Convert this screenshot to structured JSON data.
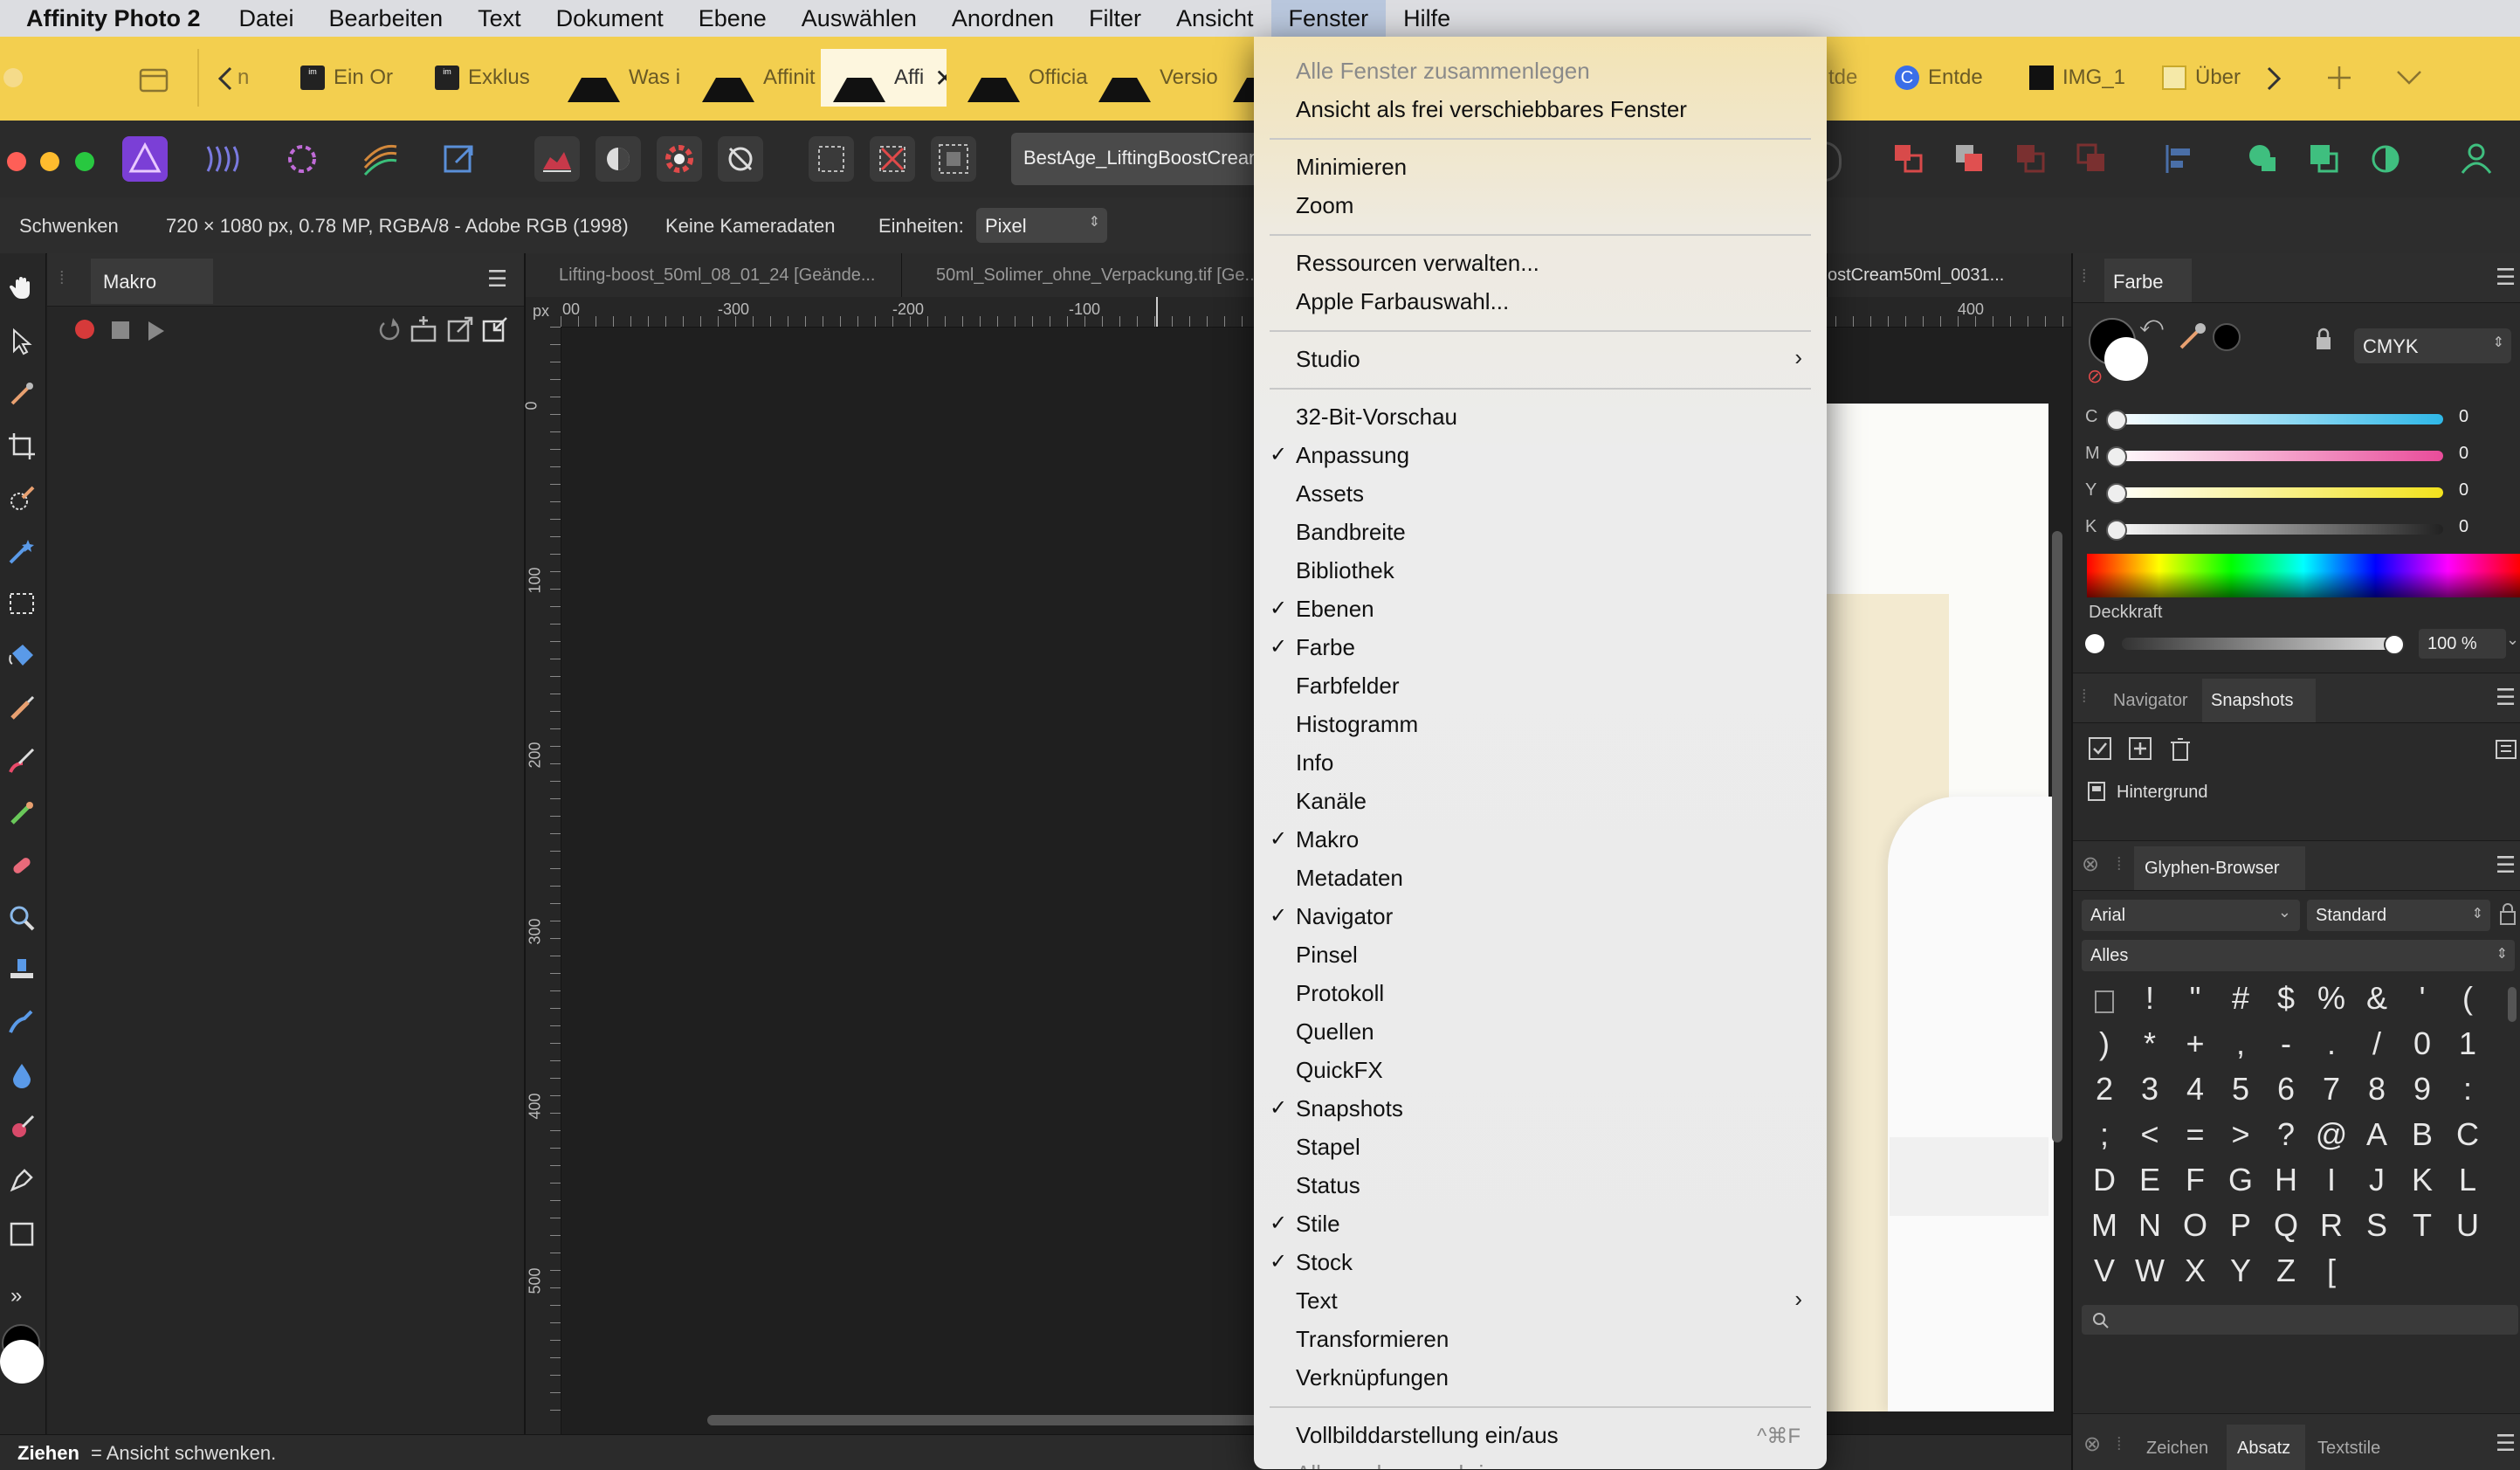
{
  "menubar": {
    "app": "Affinity Photo 2",
    "items": [
      "Datei",
      "Bearbeiten",
      "Text",
      "Dokument",
      "Ebene",
      "Auswählen",
      "Anordnen",
      "Filter",
      "Ansicht",
      "Fenster",
      "Hilfe"
    ]
  },
  "tabs": [
    {
      "label": "Ein Or",
      "icon": "immowelt-icon"
    },
    {
      "label": "Exklus",
      "icon": "immowelt-icon"
    },
    {
      "label": "Was is",
      "icon": "affinity-icon"
    },
    {
      "label": "Affinit",
      "icon": "affinity-icon"
    },
    {
      "label": "Affi",
      "icon": "affinity-icon",
      "active": true
    },
    {
      "label": "Officia",
      "icon": "affinity-icon"
    },
    {
      "label": "Versio",
      "icon": "affinity-icon"
    },
    {
      "label": "Entde",
      "icon": "c-icon"
    },
    {
      "label": "IMG_1",
      "icon": "img-icon"
    },
    {
      "label": "Über",
      "icon": "uber-icon"
    }
  ],
  "tabs_misc": {
    "partial_left": "n",
    "partial_right": "tde"
  },
  "toolbar": {
    "document_name": "BestAge_LiftingBoostCream"
  },
  "context": {
    "tool": "Schwenken",
    "info": "720 × 1080 px, 0.78 MP, RGBA/8 - Adobe RGB (1998)",
    "camera": "Keine Kameradaten",
    "units_label": "Einheiten:",
    "units_value": "Pixel"
  },
  "makro_panel": {
    "title": "Makro"
  },
  "doc_tabs": [
    "Lifting-boost_50ml_08_01_24 [Geände...",
    "50ml_Solimer_ohne_Verpackung.tif [Ge...",
    "ostCream50ml_0031..."
  ],
  "ruler": {
    "unit": "px",
    "top_ticks": [
      "00",
      "-300",
      "-200",
      "-100",
      "400"
    ],
    "left_ticks": [
      "0",
      "100",
      "200",
      "300",
      "400",
      "500"
    ]
  },
  "dropdown": {
    "items": [
      {
        "label": "Alle Fenster zusammenlegen",
        "disabled": true
      },
      {
        "label": "Ansicht als frei verschiebbares Fenster"
      },
      {
        "sep": true
      },
      {
        "label": "Minimieren"
      },
      {
        "label": "Zoom"
      },
      {
        "sep": true
      },
      {
        "label": "Ressourcen verwalten..."
      },
      {
        "label": "Apple Farbauswahl..."
      },
      {
        "sep": true
      },
      {
        "label": "Studio",
        "submenu": true
      },
      {
        "sep": true
      },
      {
        "label": "32-Bit-Vorschau"
      },
      {
        "label": "Anpassung",
        "checked": true
      },
      {
        "label": "Assets"
      },
      {
        "label": "Bandbreite"
      },
      {
        "label": "Bibliothek"
      },
      {
        "label": "Ebenen",
        "checked": true
      },
      {
        "label": "Farbe",
        "checked": true
      },
      {
        "label": "Farbfelder"
      },
      {
        "label": "Histogramm"
      },
      {
        "label": "Info"
      },
      {
        "label": "Kanäle"
      },
      {
        "label": "Makro",
        "checked": true
      },
      {
        "label": "Metadaten"
      },
      {
        "label": "Navigator",
        "checked": true
      },
      {
        "label": "Pinsel"
      },
      {
        "label": "Protokoll"
      },
      {
        "label": "Quellen"
      },
      {
        "label": "QuickFX"
      },
      {
        "label": "Snapshots",
        "checked": true
      },
      {
        "label": "Stapel"
      },
      {
        "label": "Status"
      },
      {
        "label": "Stile",
        "checked": true
      },
      {
        "label": "Stock",
        "checked": true
      },
      {
        "label": "Text",
        "submenu": true
      },
      {
        "label": "Transformieren"
      },
      {
        "label": "Verknüpfungen"
      },
      {
        "sep": true
      },
      {
        "label": "Vollbilddarstellung ein/aus",
        "shortcut": "^⌘F"
      },
      {
        "label": "Alle nach vorne bringen",
        "disabled": true
      }
    ]
  },
  "color_panel": {
    "title": "Farbe",
    "model": "CMYK",
    "channels": [
      {
        "name": "C",
        "value": "0",
        "color": "#2fb8e8"
      },
      {
        "name": "M",
        "value": "0",
        "color": "#e94c9a"
      },
      {
        "name": "Y",
        "value": "0",
        "color": "#f2e21d"
      },
      {
        "name": "K",
        "value": "0",
        "color": "#222222"
      }
    ],
    "opacity_label": "Deckkraft",
    "opacity_value": "100 %"
  },
  "snap_panel": {
    "tabs": [
      "Navigator",
      "Snapshots"
    ],
    "item": "Hintergrund"
  },
  "glyph_panel": {
    "title": "Glyphen-Browser",
    "font": "Arial",
    "style": "Standard",
    "filter": "Alles",
    "glyphs": [
      "",
      "!",
      "\"",
      "#",
      "$",
      "%",
      "&",
      "'",
      "(",
      ")",
      "*",
      "+",
      ",",
      "-",
      ".",
      "/",
      "0",
      "1",
      "2",
      "3",
      "4",
      "5",
      "6",
      "7",
      "8",
      "9",
      ":",
      ";",
      "<",
      "=",
      ">",
      "?",
      "@",
      "A",
      "B",
      "C",
      "D",
      "E",
      "F",
      "G",
      "H",
      "I",
      "J",
      "K",
      "L",
      "M",
      "N",
      "O",
      "P",
      "Q",
      "R",
      "S",
      "T",
      "U",
      "V",
      "W",
      "X",
      "Y",
      "Z",
      "["
    ]
  },
  "bottom_panel": {
    "tabs": [
      "Zeichen",
      "Absatz",
      "Textstile"
    ]
  },
  "status": {
    "key": "Ziehen",
    "text": " = Ansicht schwenken."
  }
}
